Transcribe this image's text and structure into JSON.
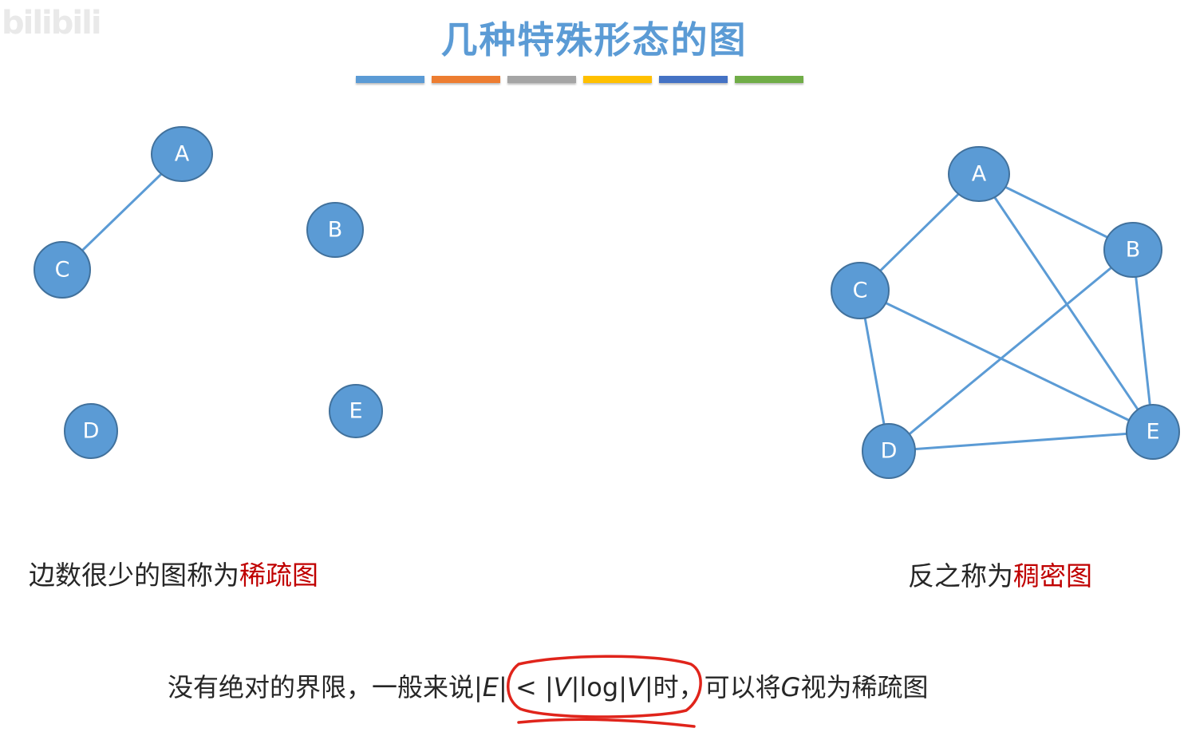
{
  "title": "几种特殊形态的图",
  "watermark": "bilibili",
  "color_bars": [
    "#5b9bd5",
    "#ed7d31",
    "#a5a5a5",
    "#ffc000",
    "#4472c4",
    "#70ad47"
  ],
  "left_graph": {
    "nodes": [
      {
        "id": "A",
        "label": "A"
      },
      {
        "id": "B",
        "label": "B"
      },
      {
        "id": "C",
        "label": "C"
      },
      {
        "id": "D",
        "label": "D"
      },
      {
        "id": "E",
        "label": "E"
      }
    ],
    "edges": [
      [
        "A",
        "C"
      ]
    ]
  },
  "right_graph": {
    "nodes": [
      {
        "id": "A",
        "label": "A"
      },
      {
        "id": "B",
        "label": "B"
      },
      {
        "id": "C",
        "label": "C"
      },
      {
        "id": "D",
        "label": "D"
      },
      {
        "id": "E",
        "label": "E"
      }
    ],
    "edges": [
      [
        "A",
        "B"
      ],
      [
        "A",
        "C"
      ],
      [
        "A",
        "E"
      ],
      [
        "B",
        "D"
      ],
      [
        "B",
        "E"
      ],
      [
        "C",
        "D"
      ],
      [
        "C",
        "E"
      ],
      [
        "D",
        "E"
      ]
    ]
  },
  "left_caption": {
    "prefix": "边数很少的图称为",
    "highlight": "稀疏图"
  },
  "right_caption": {
    "prefix": "反之称为",
    "highlight": "稠密图"
  },
  "footer": {
    "before": "没有绝对的界限，一般来说",
    "formula": {
      "e": "E",
      "lt": "<",
      "v": "V",
      "log": "log"
    },
    "after_pre": "时，可以将",
    "g": "G",
    "after_post": "视为稀疏图"
  },
  "colors": {
    "node_fill": "#5b9bd5",
    "node_stroke": "#41719c",
    "highlight": "#c00000",
    "ink": "#e0241b"
  }
}
